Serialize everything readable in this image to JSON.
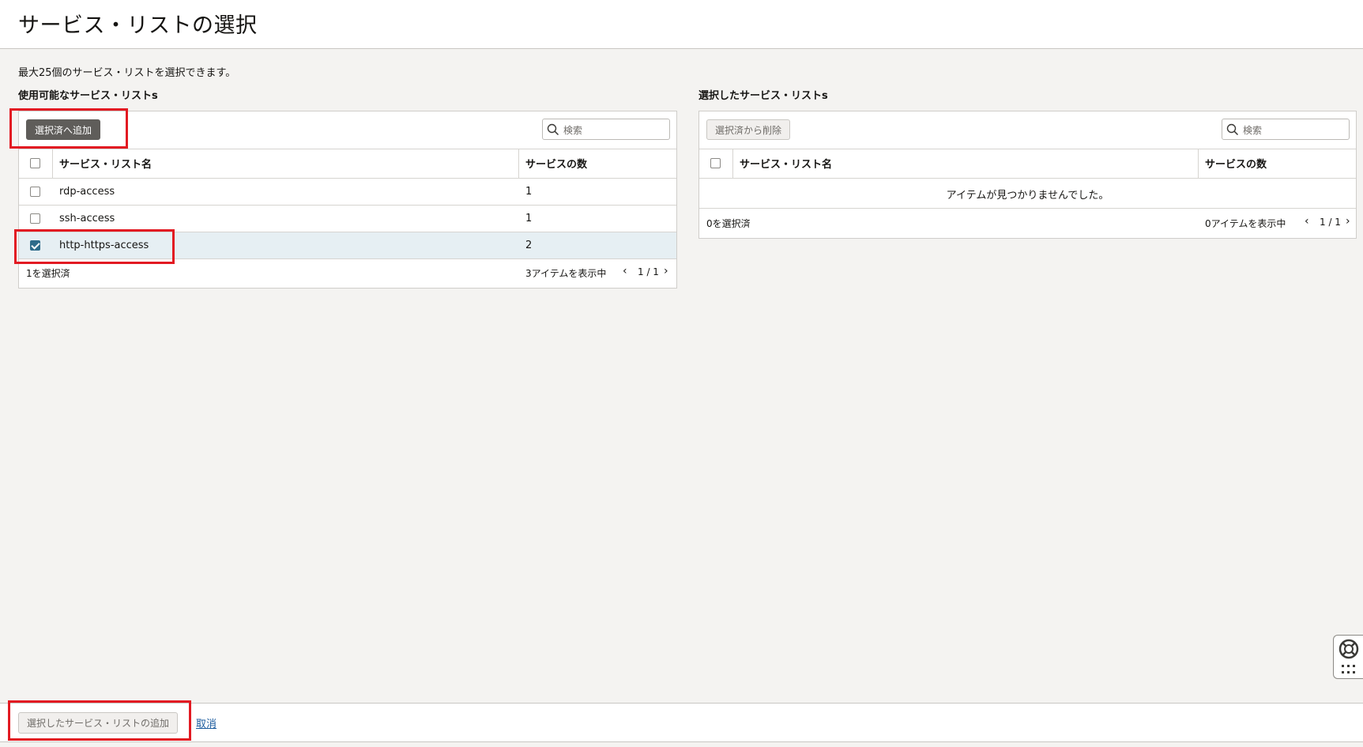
{
  "page": {
    "title": "サービス・リストの選択",
    "description": "最大25個のサービス・リストを選択できます。"
  },
  "available": {
    "label": "使用可能なサービス・リストs",
    "add_button": "選択済へ追加",
    "search_placeholder": "検索",
    "columns": [
      "サービス・リスト名",
      "サービスの数"
    ],
    "rows": [
      {
        "name": "rdp-access",
        "count": "1",
        "checked": false
      },
      {
        "name": "ssh-access",
        "count": "1",
        "checked": false
      },
      {
        "name": "http-https-access",
        "count": "2",
        "checked": true
      }
    ],
    "selected_count": "1を選択済",
    "showing": "3アイテムを表示中",
    "page": "1 / 1"
  },
  "selected": {
    "label": "選択したサービス・リストs",
    "remove_button": "選択済から削除",
    "search_placeholder": "検索",
    "columns": [
      "サービス・リスト名",
      "サービスの数"
    ],
    "empty_message": "アイテムが見つかりませんでした。",
    "selected_count": "0を選択済",
    "showing": "0アイテムを表示中",
    "page": "1 / 1"
  },
  "footer": {
    "submit_button": "選択したサービス・リストの追加",
    "cancel_link": "取消"
  },
  "icons": {
    "search": "search-icon",
    "prev": "chevron-left-icon",
    "next": "chevron-right-icon",
    "help": "lifebuoy-icon",
    "apps": "grid-icon"
  },
  "colors": {
    "highlight": "#e21a22",
    "primary_button": "#5f5d5a",
    "checkbox_checked": "#2e6b8a",
    "link": "#1b5b9e"
  }
}
